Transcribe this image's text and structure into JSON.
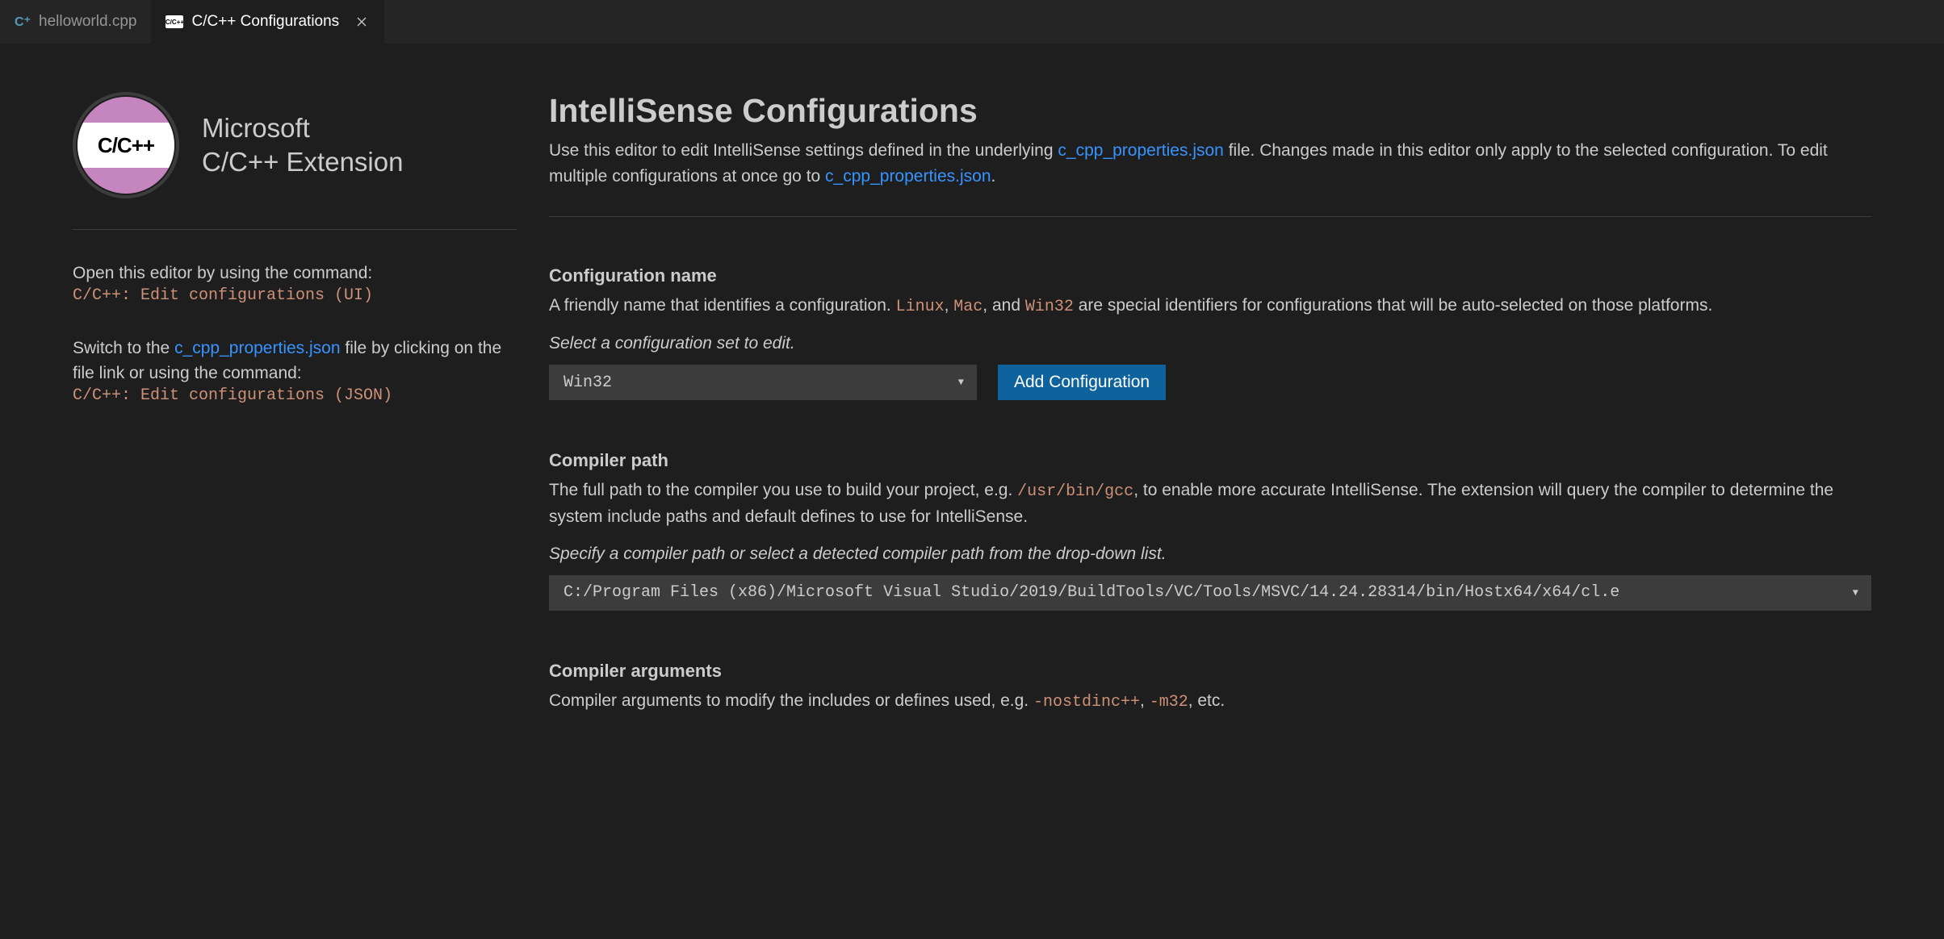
{
  "tabs": [
    {
      "label": "helloworld.cpp",
      "icon": "cpp"
    },
    {
      "label": "C/C++ Configurations",
      "icon": "ccpp-config",
      "active": true
    }
  ],
  "extension": {
    "logoText": "C/C++",
    "vendor": "Microsoft",
    "name": "C/C++ Extension"
  },
  "sidebar": {
    "openEditorText": "Open this editor by using the command:",
    "openEditorCmd": "C/C++: Edit configurations (UI)",
    "switchPrefix": "Switch to the ",
    "switchLink": "c_cpp_properties.json",
    "switchSuffix": " file by clicking on the file link or using the command:",
    "switchCmd": "C/C++: Edit configurations (JSON)"
  },
  "main": {
    "title": "IntelliSense Configurations",
    "subtitle": {
      "prefix": "Use this editor to edit IntelliSense settings defined in the underlying ",
      "link1": "c_cpp_properties.json",
      "mid": " file. Changes made in this editor only apply to the selected configuration. To edit multiple configurations at once go to ",
      "link2": "c_cpp_properties.json",
      "suffix": "."
    }
  },
  "configName": {
    "title": "Configuration name",
    "desc": {
      "p1": "A friendly name that identifies a configuration. ",
      "c1": "Linux",
      "p2": ", ",
      "c2": "Mac",
      "p3": ", and ",
      "c3": "Win32",
      "p4": " are special identifiers for configurations that will be auto-selected on those platforms."
    },
    "hint": "Select a configuration set to edit.",
    "selected": "Win32",
    "addButton": "Add Configuration"
  },
  "compilerPath": {
    "title": "Compiler path",
    "desc": {
      "p1": "The full path to the compiler you use to build your project, e.g. ",
      "c1": "/usr/bin/gcc",
      "p2": ", to enable more accurate IntelliSense. The extension will query the compiler to determine the system include paths and default defines to use for IntelliSense."
    },
    "hint": "Specify a compiler path or select a detected compiler path from the drop-down list.",
    "value": "C:/Program Files (x86)/Microsoft Visual Studio/2019/BuildTools/VC/Tools/MSVC/14.24.28314/bin/Hostx64/x64/cl.e"
  },
  "compilerArgs": {
    "title": "Compiler arguments",
    "desc": {
      "p1": "Compiler arguments to modify the includes or defines used, e.g. ",
      "c1": "-nostdinc++",
      "p2": ", ",
      "c2": "-m32",
      "p3": ", etc."
    }
  }
}
